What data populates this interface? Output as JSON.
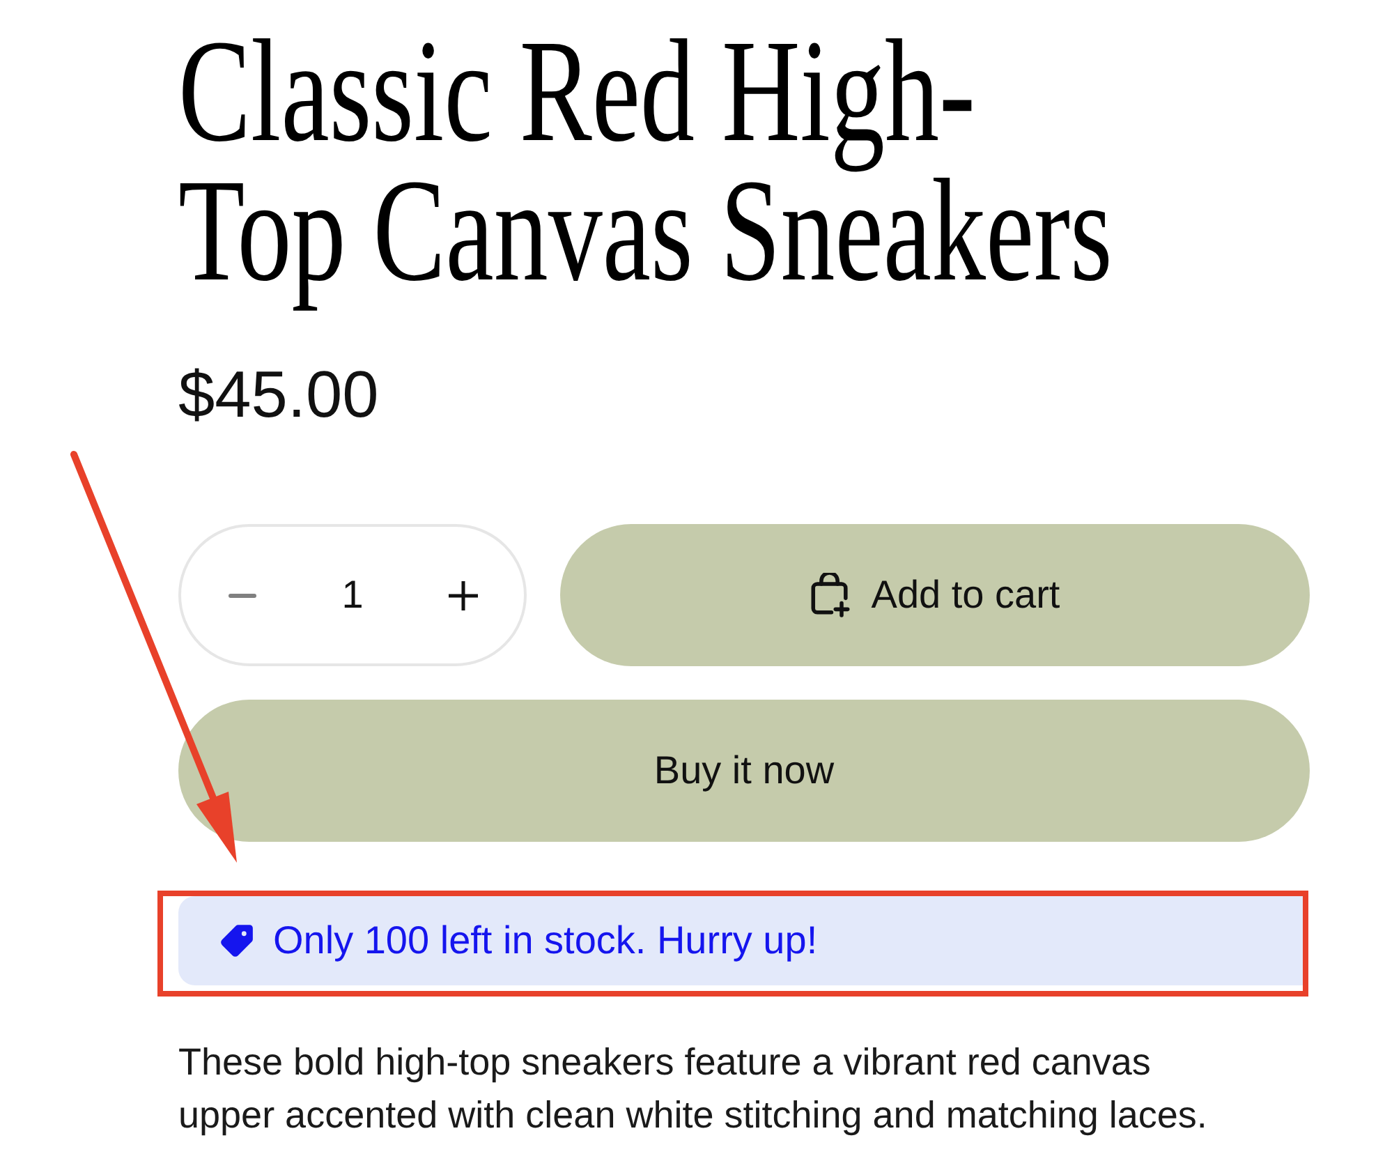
{
  "product": {
    "title": "Classic Red High-Top Canvas Sneakers",
    "price": "$45.00"
  },
  "quantity": {
    "value": "1",
    "decrease": {
      "disabled": true
    },
    "increase": {
      "disabled": false
    }
  },
  "buttons": [
    {
      "kind": "add_to_cart",
      "label": "Add to cart"
    },
    {
      "kind": "buy_now",
      "label": "Buy it now"
    }
  ],
  "stock_notice": {
    "text": "Only 100 left in stock. Hurry up!",
    "highlighted": true
  },
  "description": "These bold high-top sneakers feature a vibrant red canvas upper accented with clean white stitching and matching laces."
}
